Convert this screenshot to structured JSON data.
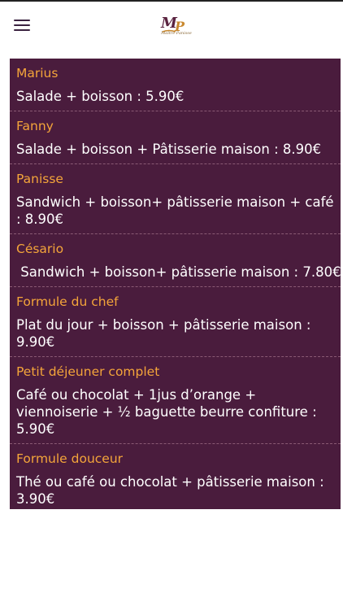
{
  "header": {
    "logo_letters": "MP",
    "logo_subtext": "Maître Panisse"
  },
  "menu": {
    "items": [
      {
        "name": "Marius",
        "desc": "Salade + boisson : 5.90€"
      },
      {
        "name": "Fanny",
        "desc": "Salade + boisson + Pâtisserie maison : 8.90€"
      },
      {
        "name": "Panisse",
        "desc": "Sandwich + boisson+ pâtisserie maison + café : 8.90€"
      },
      {
        "name": "Césario",
        "desc": " Sandwich + boisson+ pâtisserie maison : 7.80€"
      },
      {
        "name": "Formule du chef",
        "desc": "Plat du jour + boisson + pâtisserie maison : 9.90€"
      },
      {
        "name": "Petit déjeuner complet",
        "desc": "Café ou chocolat + 1jus d’orange + viennoiserie + ½ baguette beurre confiture : 5.90€"
      },
      {
        "name": "Formule douceur",
        "desc": "Thé ou café ou chocolat + pâtisserie maison : 3.90€"
      }
    ]
  },
  "colors": {
    "panel_bg": "#4a1c3d",
    "item_title": "#f4a53a",
    "item_text": "#ffffff",
    "menu_icon": "#3a2240"
  }
}
